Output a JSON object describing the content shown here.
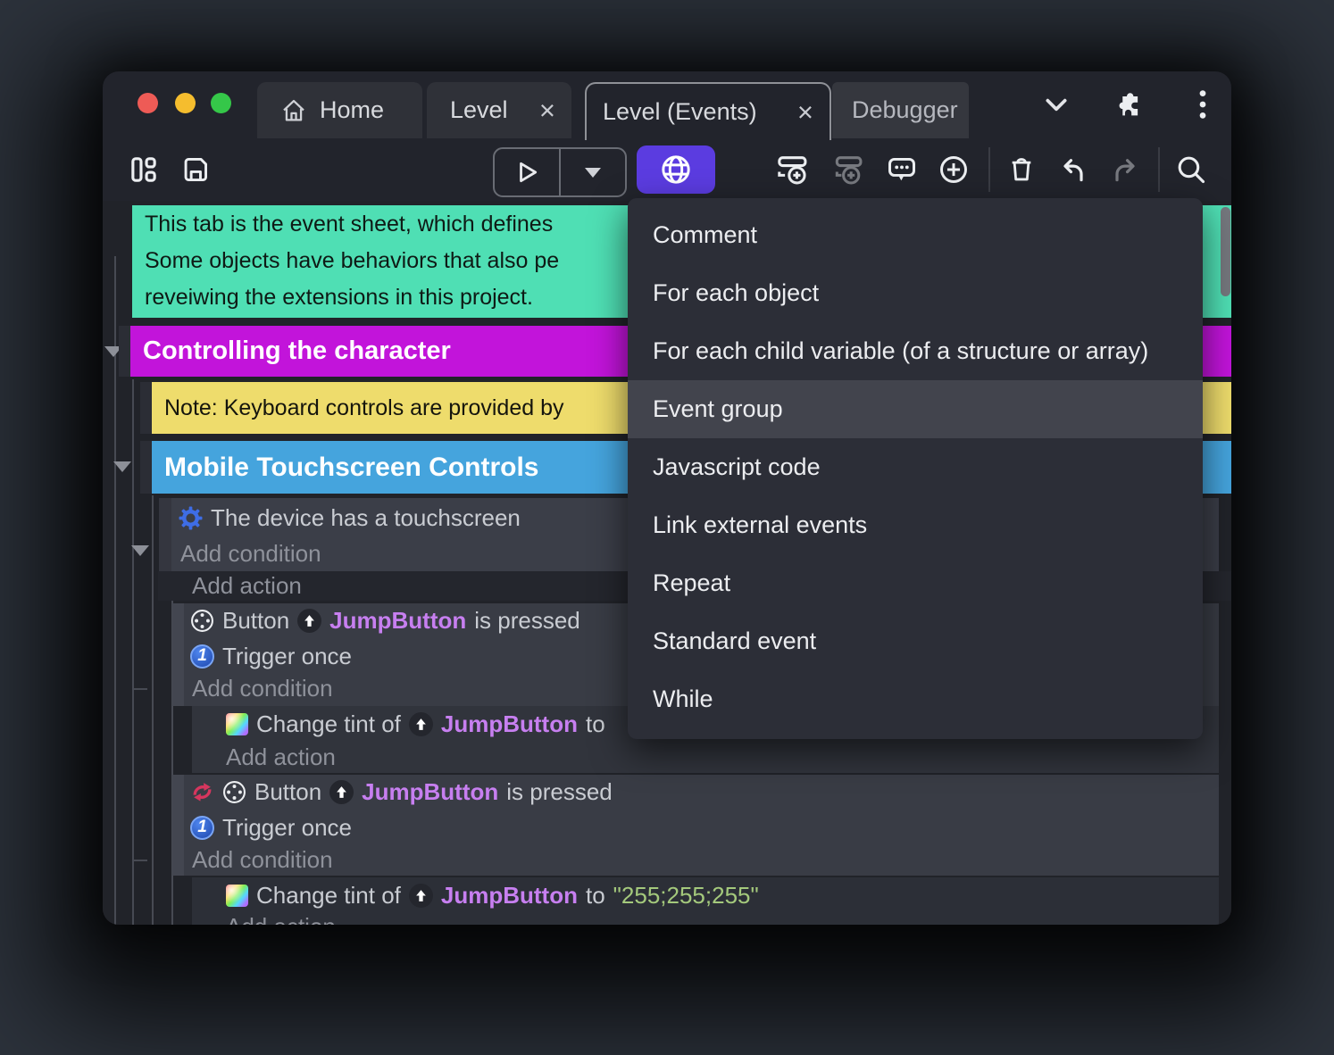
{
  "colors": {
    "bg_page": "#2c323b",
    "window_bg": "#22242c",
    "tab_bg": "#2f3138",
    "tab_debugger": "#35373e",
    "accent": "#5b3ce0",
    "sheet_bg": "#212329",
    "teal": "#4fdfb4",
    "magenta": "#c214da",
    "yellow": "#eedc6c",
    "blue": "#45a4dd",
    "menu_bg": "#2c2e37",
    "menu_hl": "#42444d",
    "obj": "#c77ff0",
    "green": "#a4c97c"
  },
  "titlebar": {
    "tabs": {
      "home": "Home",
      "level": "Level",
      "level_events": "Level (Events)",
      "debugger": "Debugger"
    },
    "close_glyph": "×"
  },
  "menu": {
    "items": [
      "Comment",
      "For each object",
      "For each child variable (of a structure or array)",
      "Event group",
      "Javascript code",
      "Link external events",
      "Repeat",
      "Standard event",
      "While"
    ],
    "highlighted": "Event group"
  },
  "sheet": {
    "comment_lines": [
      "This tab is the event sheet, which defines",
      "Some objects have behaviors that also pe",
      "reveiwing the extensions in this project."
    ],
    "group1": "Controlling the character",
    "note": "Note: Keyboard controls are provided by",
    "group2": "Mobile Touchscreen Controls",
    "condition_touchscreen": "The device has a touchscreen",
    "add_condition": "Add condition",
    "add_action": "Add action",
    "event1": {
      "label": "Button",
      "object": "JumpButton",
      "predicate": "is pressed",
      "trigger": "Trigger once"
    },
    "action1": {
      "pre": "Change tint of",
      "object": "JumpButton",
      "post": "to",
      "value": ""
    },
    "event2": {
      "label": "Button",
      "object": "JumpButton",
      "predicate": "is pressed",
      "trigger": "Trigger once"
    },
    "action2": {
      "pre": "Change tint of",
      "object": "JumpButton",
      "post": "to",
      "value": "\"255;255;255\""
    },
    "trigger_badge": "1"
  }
}
